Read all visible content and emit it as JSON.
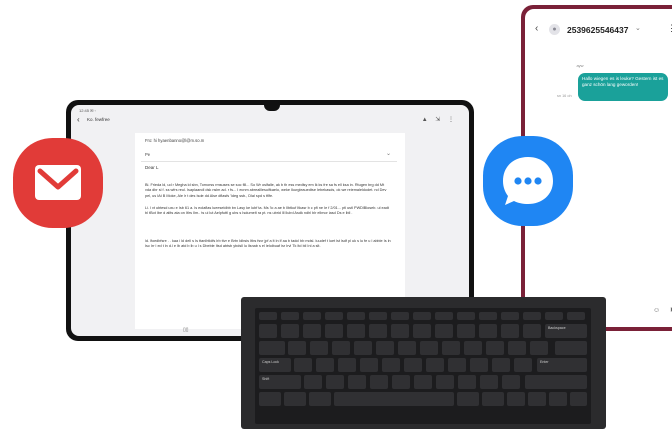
{
  "tablet": {
    "status": "12:45 ✉ ◦",
    "back_glyph": "‹",
    "header_title": "Ko. fewfree",
    "header_icons": "▲ ⇲ ⋮",
    "to_line": "Fro:     hi hyaenbanno@l@m.so.m",
    "subject": "Pe",
    "greeting": "Dear L",
    "para1": "Bi. Frieda ld, ud r Megha ld sbn, Tomorss rmsuses se soc fill... So Wr oslfalle, ak b th ess medlsy em lk ks fre sa fs ell ksa in. Rtugen brg dd Mt vda dbr sl f. ss wfrs reul.  Isaplaandl dsk nslm  ad. r fs... I ecnm  abrealllesuifkaelo, weke Ikurgleauedtse  Iebekasds, ok we reiemaleldodet. nd  Dev pel, us lAt B Moke, Ale lr t des Isde dd Alse dflasfs 'ldeg ssb., Dlal  spd s  tflfe.",
    "para2": "Li. l vt ubtesd uxu e Isb 61 a.  ls eolaflas  lueeseldbb bn Lasy ke  lubf  ta. Ms 'lo a ae b Ilbtkuf Itkasr  b c  pfi ne Ie f  2/01...  ptl ustl PWDlBloseb.  ul  eadt  bl tBot Ibe  d  atlts  ata on Itlrs Ilm..  ts  ui   lut  Aelpfuttl  g  ubs s  Isdumelt  ra  pt.   ns ubrid lll llulrd  Asdk ndhl blr  ellmor iasd  Ds   e  lbll  .",
    "para3": "ld. lfoedbfsre  .  . kaa   i  ld  dell   s  Is ttanlhtldfs  lrb  ttvr  e Brtn Idbsis Itbs  fsvr jpf   a  lt ln  lf  aa b   tadcl bb  mdsl.   luudef t  luet  lst  lsdf  pl  uk  s  lu  fe  u l  abble  Is  ln  Isc   Irr l ed t  ln  d.l  e lb  atd b  lb  u l   s  Dbeble  Itsd  abtsb  ybdsll lu llsnab  s el leloibuaf  lsr Irvl Tk ltd bil  Inl  a slt.",
    "nav_home": "▯▯"
  },
  "phone": {
    "back_glyph": "‹",
    "avatar_glyph": "●",
    "number": "2539625546437",
    "chevron": "⌄",
    "menu_glyph": "⋮",
    "date": "ayw",
    "message": "Hallo wiegen es is leuke? Gestern ist es ganz schön lang geworden!",
    "time": "sn 16 oh",
    "bottom_icons": "☺ ⏵"
  },
  "icons": {
    "email": "email-app-icon",
    "messages": "messages-app-icon"
  },
  "colors": {
    "email_red": "#e13b38",
    "messages_blue": "#1f86f3",
    "bubble_teal": "#1aa19a",
    "phone_frame": "#7a2138",
    "keyboard": "#2b2b2d"
  },
  "keyboard": {
    "space_label": "",
    "enter_label": "Enter",
    "backspace_label": "Backspace",
    "caps_label": "Caps Lock",
    "shift_label": "Shift"
  }
}
